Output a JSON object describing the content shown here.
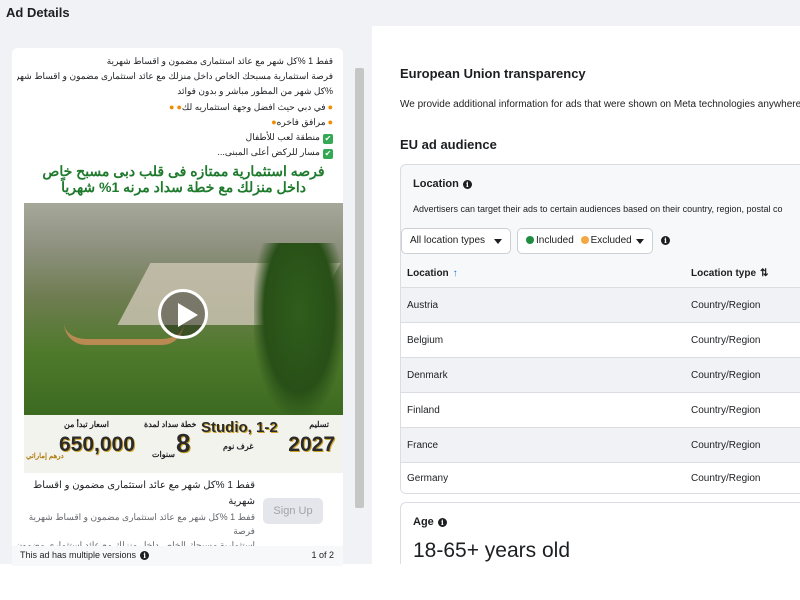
{
  "header": {
    "title": "Ad Details"
  },
  "ad": {
    "body_lines": [
      "قفط 1 %كل شهر مع عائد استثمارى مضمون و اقساط شهرية",
      "فرصة استثمارية مسبحك الخاص داخل منزلك مع عائد استثمارى مضمون و اقساط شهرية قفط 1",
      "%كل شهر من المطور مباشر و بدون فوائد",
      "في دبي حيث افضل وجهة استثماريه لك",
      "مرافق فاخره",
      "منطقة لعب للأطفال",
      "مسار للركض أعلى المبنى..."
    ],
    "creative": {
      "headline_line1": "فرصه استثمارية ممتازه فى قلب دبى مسبح خاص",
      "headline_line2": "داخل منزلك  مع خطة سداد مرنه 1%  شهرياً",
      "banner": {
        "delivery_label": "تسليم",
        "delivery_year": "2027",
        "unit_type": "Studio, 1-2",
        "unit_label": "غرف نوم",
        "plan_label": "خطة سداد لمدة",
        "plan_years": "8",
        "plan_unit": "سنوات",
        "price_label": "اسعار تبدأ من",
        "price_value": "650,000",
        "price_currency": "درهم إماراتي"
      }
    },
    "cta": {
      "text_line1": "قفط 1 %كل شهر مع عائد استثمارى مضمون و اقساط شهرية",
      "text_line2": "قفط 1 %كل شهر مع عائد استثمارى مضمون و اقساط شهرية فرصة",
      "text_line3": "استثمارية مسبحك الخاص داخل منزلك مع عائد استثمارى مضمون و اقساط...",
      "button_label": "Sign Up"
    },
    "versions": {
      "text": "This ad has multiple versions",
      "page": "1 of 2"
    }
  },
  "transparency": {
    "title": "European Union transparency",
    "description": "We provide additional information for ads that were shown on Meta technologies anywhere in the",
    "audience_title": "EU ad audience",
    "location": {
      "title": "Location",
      "description": "Advertisers can target their ads to certain audiences based on their country, region, postal co",
      "filter_label": "All location types",
      "included_label": "Included",
      "excluded_label": "Excluded",
      "col_location": "Location",
      "col_type": "Location type",
      "rows": [
        {
          "location": "Austria",
          "type": "Country/Region"
        },
        {
          "location": "Belgium",
          "type": "Country/Region"
        },
        {
          "location": "Denmark",
          "type": "Country/Region"
        },
        {
          "location": "Finland",
          "type": "Country/Region"
        },
        {
          "location": "France",
          "type": "Country/Region"
        },
        {
          "location": "Germany",
          "type": "Country/Region"
        }
      ]
    },
    "age": {
      "title": "Age",
      "value": "18-65+ years old"
    }
  },
  "colors": {
    "included_dot": "#1e8e3e",
    "excluded_dot": "#f4a742",
    "sort_accent": "#1b74e4",
    "headline_green": "#1e7a2c"
  },
  "icons": {
    "check": "✔",
    "fire": "🔥",
    "info": "i",
    "sort_up": "↑",
    "sort_both": "⇅"
  }
}
